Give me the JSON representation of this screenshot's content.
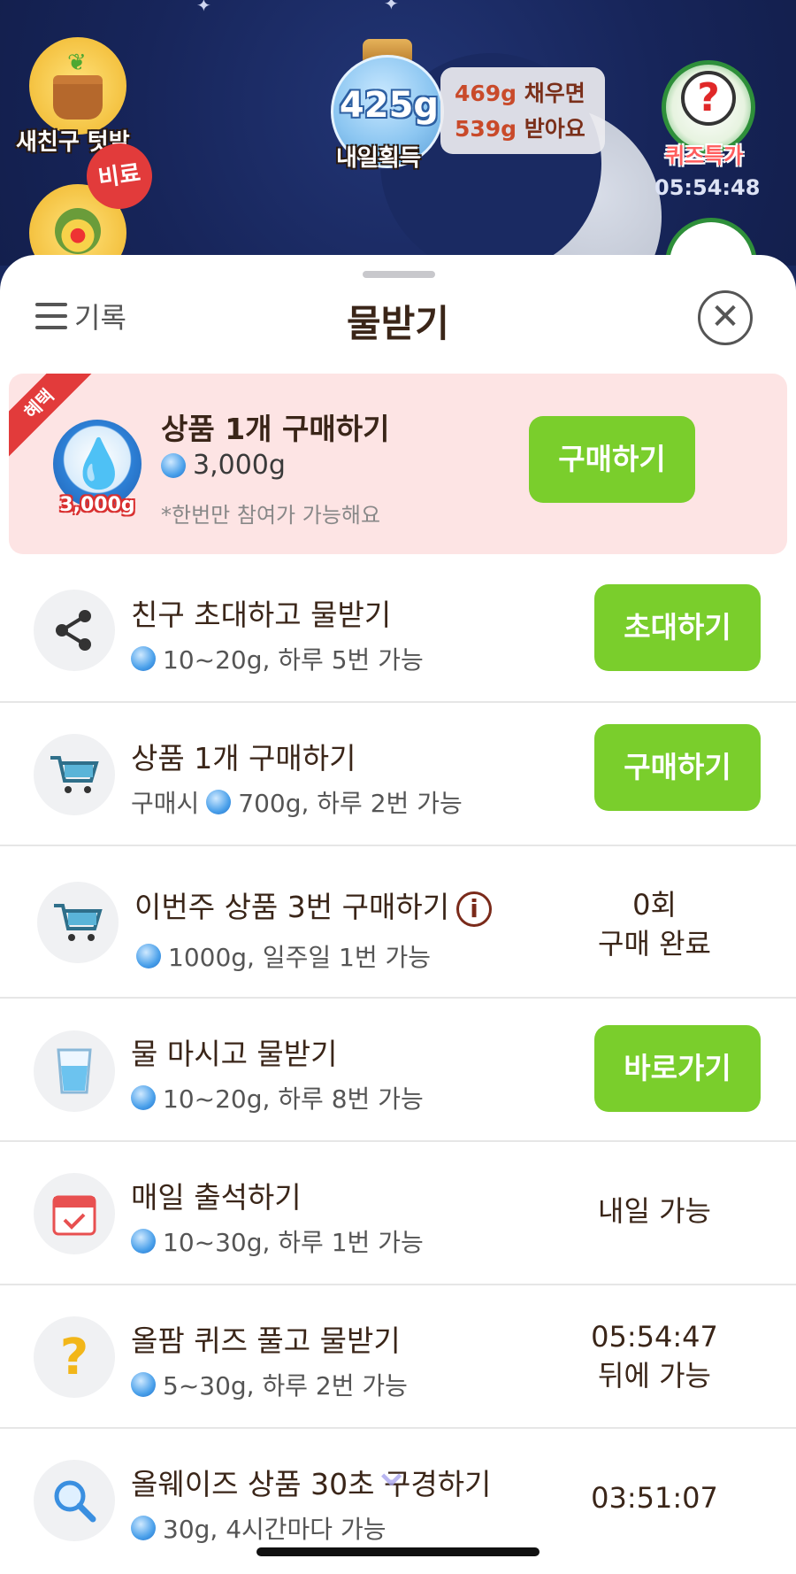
{
  "game": {
    "friend_label": "새친구 텃밭",
    "fertilizer_tag": "비료",
    "jar_amount": "425g",
    "jar_label": "내일획득",
    "bubble_line1_amount": "469g",
    "bubble_line1_text": " 채우면",
    "bubble_line2_amount": "539g",
    "bubble_line2_text": " 받아요",
    "quiz_label": "퀴즈특가",
    "quiz_timer": "05:54:48"
  },
  "sheet": {
    "history_label": "기록",
    "title": "물받기",
    "close_glyph": "✕"
  },
  "promo": {
    "ribbon": "혜택",
    "coin_label": "3,000g",
    "title": "상품 1개 구매하기",
    "reward": "3,000g",
    "note": "*한번만 참여가 가능해요",
    "button": "구매하기"
  },
  "tasks": [
    {
      "icon": "share-icon",
      "title": "친구 초대하고 물받기",
      "sub_prefix": "",
      "sub": "10~20g, 하루 5번 가능",
      "button": "초대하기"
    },
    {
      "icon": "cart-icon",
      "title": "상품 1개 구매하기",
      "sub_prefix": "구매시",
      "sub": "700g, 하루 2번 가능",
      "button": "구매하기"
    },
    {
      "icon": "cart-icon",
      "title": "이번주 상품 3번 구매하기",
      "sub_prefix": "",
      "sub": "1000g, 일주일 1번 가능",
      "status_line1": "0회",
      "status_line2": "구매 완료"
    },
    {
      "icon": "water-glass-icon",
      "title": "물 마시고 물받기",
      "sub_prefix": "",
      "sub": "10~20g, 하루 8번 가능",
      "button": "바로가기"
    },
    {
      "icon": "calendar-icon",
      "title": "매일 출석하기",
      "sub_prefix": "",
      "sub": "10~30g, 하루 1번 가능",
      "status_line1": "내일 가능"
    },
    {
      "icon": "question-icon",
      "title": "올팜 퀴즈 풀고 물받기",
      "sub_prefix": "",
      "sub": "5~30g, 하루 2번 가능",
      "status_line1": "05:54:47",
      "status_line2": "뒤에 가능"
    },
    {
      "icon": "search-icon",
      "title": "올웨이즈 상품 30초 구경하기",
      "sub_prefix": "",
      "sub": "30g, 4시간마다 가능",
      "status_line1": "03:51:07"
    }
  ]
}
